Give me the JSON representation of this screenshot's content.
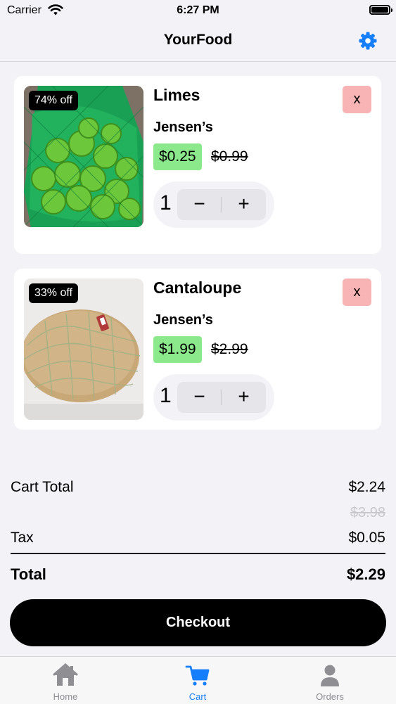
{
  "status_bar": {
    "carrier": "Carrier",
    "time": "6:27 PM"
  },
  "nav": {
    "title": "YourFood",
    "settings_icon": "gear-icon"
  },
  "cart_items": [
    {
      "name": "Limes",
      "store": "Jensen’s",
      "discount": "74% off",
      "sale_price": "$0.25",
      "original_price": "$0.99",
      "quantity": "1",
      "remove_label": "x"
    },
    {
      "name": "Cantaloupe",
      "store": "Jensen’s",
      "discount": "33% off",
      "sale_price": "$1.99",
      "original_price": "$2.99",
      "quantity": "1",
      "remove_label": "x"
    }
  ],
  "stepper": {
    "minus": "−",
    "plus": "+"
  },
  "summary": {
    "cart_total_label": "Cart Total",
    "cart_total": "$2.24",
    "original_total": "$3.98",
    "tax_label": "Tax",
    "tax": "$0.05",
    "total_label": "Total",
    "total": "$2.29"
  },
  "checkout_label": "Checkout",
  "tabs": [
    {
      "label": "Home",
      "icon": "home-icon"
    },
    {
      "label": "Cart",
      "icon": "cart-icon",
      "active": true
    },
    {
      "label": "Orders",
      "icon": "person-icon"
    }
  ],
  "colors": {
    "accent": "#147efb",
    "sale_price_bg": "#8be88b",
    "remove_bg": "#f8b3b5",
    "background": "#f2f2f7"
  }
}
